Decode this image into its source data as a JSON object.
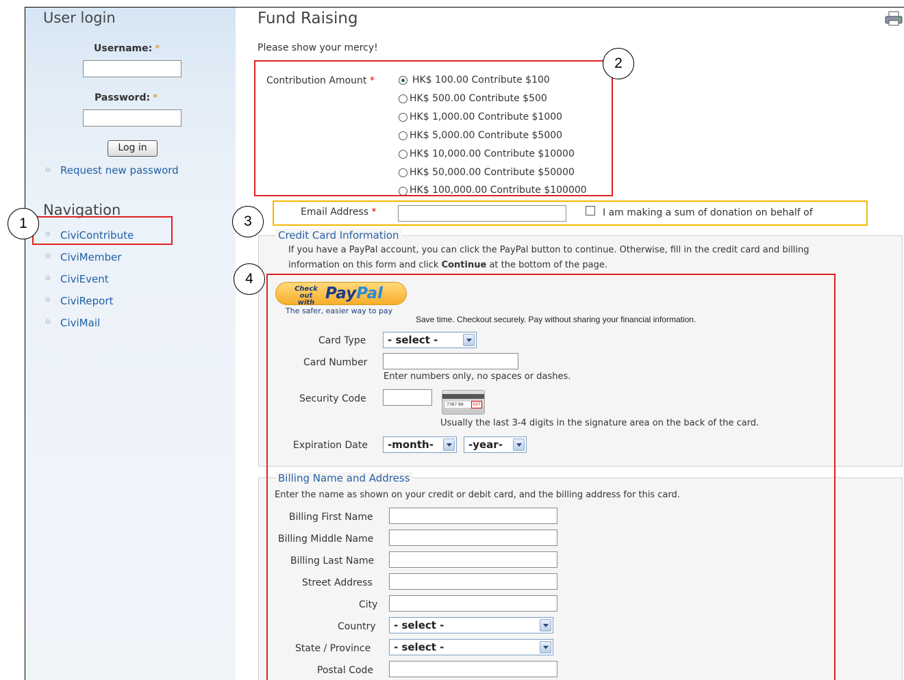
{
  "sidebar": {
    "login_title": "User login",
    "username_label": "Username:",
    "password_label": "Password:",
    "required_mark": "*",
    "login_button": "Log in",
    "request_password": "Request new password",
    "nav_title": "Navigation",
    "nav_items": [
      "CiviContribute",
      "CiviMember",
      "CiviEvent",
      "CiviReport",
      "CiviMail"
    ]
  },
  "main": {
    "title": "Fund Raising",
    "intro": "Please show your mercy!",
    "contribution_label": "Contribution Amount",
    "amounts": [
      "HK$ 100.00 Contribute $100",
      "HK$ 500.00 Contribute $500",
      "HK$ 1,000.00 Contribute $1000",
      "HK$ 5,000.00 Contribute $5000",
      "HK$ 10,000.00 Contribute $10000",
      "HK$ 50,000.00 Contribute $50000",
      "HK$ 100,000.00 Contribute $100000"
    ],
    "selected_amount_index": 0,
    "email_label": "Email Address",
    "behalf_label": "I am making a sum of donation on behalf of",
    "cc": {
      "legend": "Credit Card Information",
      "help_line1": "If you have a PayPal account, you can click the PayPal button to continue. Otherwise, fill in the credit card and billing",
      "help_line2_pre": "information on this form and click",
      "help_line2_bold": "Continue",
      "help_line2_post": "at the bottom of the page.",
      "paypal_checkout": "Check out with",
      "paypal_brand_a": "Pay",
      "paypal_brand_b": "Pal",
      "paypal_tagline": "The safer, easier way to pay",
      "paypal_note": "Save time. Checkout securely. Pay without sharing your financial information.",
      "card_type_label": "Card Type",
      "card_type_value": "- select -",
      "card_number_label": "Card Number",
      "card_number_help": "Enter numbers only, no spaces or dashes.",
      "security_label": "Security Code",
      "security_help": "Usually the last 3-4 digits in the signature area on the back of the card.",
      "expiry_label": "Expiration Date",
      "month_value": "-month-",
      "year_value": "-year-"
    },
    "billing": {
      "legend": "Billing Name and Address",
      "help": "Enter the name as shown on your credit or debit card, and the billing address for this card.",
      "first_name": "Billing First Name",
      "middle_name": "Billing Middle Name",
      "last_name": "Billing Last Name",
      "street": "Street Address",
      "city": "City",
      "country": "Country",
      "country_value": "- select -",
      "state": "State / Province",
      "state_value": "- select -",
      "postal": "Postal Code"
    }
  },
  "annotations": [
    "1",
    "2",
    "3",
    "4"
  ],
  "colors": {
    "link": "#1f5fa5",
    "legend": "#2a5fa5",
    "annotation_red": "#e02020",
    "annotation_yellow": "#f5b800"
  }
}
